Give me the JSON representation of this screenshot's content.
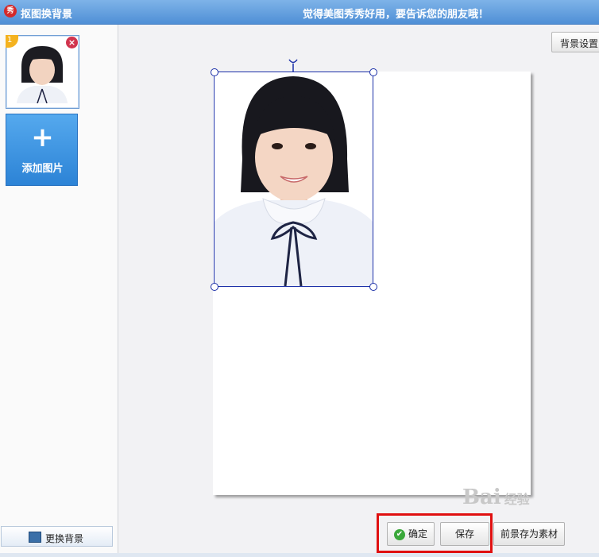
{
  "window": {
    "title": "抠图换背景",
    "slogan": "觉得美图秀秀好用，要告诉您的朋友哦！"
  },
  "sidebar": {
    "thumbnail_index": "1",
    "add_image_label": "添加图片",
    "change_background_label": "更换背景"
  },
  "toolbar": {
    "background_settings_label": "背景设置"
  },
  "actions": {
    "confirm_label": "确定",
    "save_label": "保存",
    "save_foreground_label": "前景存为素材"
  },
  "watermark": {
    "text": "Bai",
    "suffix": "经验"
  },
  "colors": {
    "selection": "#1b2fa8",
    "highlight": "#e01010",
    "titlebar": "#5b9ae0"
  }
}
